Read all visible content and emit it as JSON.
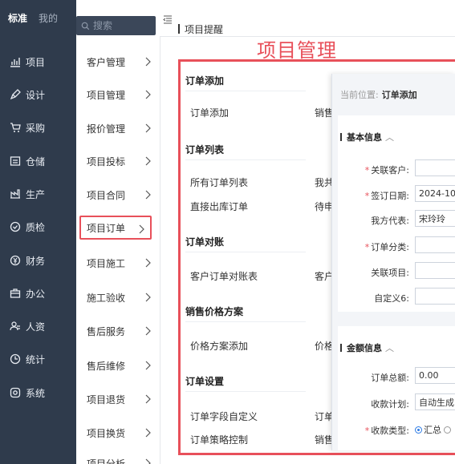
{
  "rail": {
    "tabs": [
      {
        "label": "标准",
        "active": true
      },
      {
        "label": "我的",
        "active": false
      }
    ],
    "items": [
      {
        "label": "项目",
        "icon": "chart-icon"
      },
      {
        "label": "设计",
        "icon": "pen-icon"
      },
      {
        "label": "采购",
        "icon": "cart-icon"
      },
      {
        "label": "仓储",
        "icon": "warehouse-icon"
      },
      {
        "label": "生产",
        "icon": "factory-icon"
      },
      {
        "label": "质检",
        "icon": "check-circle-icon"
      },
      {
        "label": "财务",
        "icon": "yen-icon"
      },
      {
        "label": "办公",
        "icon": "briefcase-icon"
      },
      {
        "label": "人资",
        "icon": "people-icon"
      },
      {
        "label": "统计",
        "icon": "clock-icon"
      },
      {
        "label": "系统",
        "icon": "settings-icon"
      }
    ]
  },
  "search": {
    "placeholder": "搜索"
  },
  "submenu": {
    "items": [
      {
        "label": "客户管理"
      },
      {
        "label": "项目管理"
      },
      {
        "label": "报价管理"
      },
      {
        "label": "项目投标"
      },
      {
        "label": "项目合同"
      },
      {
        "label": "项目订单",
        "selected": true
      },
      {
        "label": "项目施工"
      },
      {
        "label": "施工验收"
      },
      {
        "label": "售后服务"
      },
      {
        "label": "售后维修"
      },
      {
        "label": "项目退货"
      },
      {
        "label": "项目换货"
      },
      {
        "label": "项目分析"
      }
    ]
  },
  "header": {
    "breadcrumb": "项目提醒"
  },
  "big_title": "项目管理",
  "panel": {
    "groups": [
      {
        "title": "订单添加",
        "links": [
          {
            "left": "订单添加",
            "right": "销售"
          }
        ]
      },
      {
        "title": "订单列表",
        "links": [
          {
            "left": "所有订单列表",
            "right": "我共"
          },
          {
            "left": "直接出库订单",
            "right": "待申"
          }
        ]
      },
      {
        "title": "订单对账",
        "links": [
          {
            "left": "客户订单对账表",
            "right": "客户"
          }
        ]
      },
      {
        "title": "销售价格方案",
        "links": [
          {
            "left": "价格方案添加",
            "right": "价格"
          }
        ]
      },
      {
        "title": "订单设置",
        "links": [
          {
            "left": "订单字段自定义",
            "right": "订单"
          },
          {
            "left": "订单策略控制",
            "right": "销售"
          }
        ]
      }
    ]
  },
  "form": {
    "crumb_prefix": "当前位置:",
    "crumb_current": "订单添加",
    "basic": {
      "title": "基本信息",
      "fields": [
        {
          "label": "关联客户:",
          "required": true,
          "value": ""
        },
        {
          "label": "签订日期:",
          "required": true,
          "value": "2024-10-"
        },
        {
          "label": "我方代表:",
          "required": false,
          "value": "宋玲玲"
        },
        {
          "label": "订单分类:",
          "required": true,
          "value": ""
        },
        {
          "label": "关联项目:",
          "required": false,
          "value": ""
        },
        {
          "label": "自定义6:",
          "required": false,
          "value": ""
        }
      ]
    },
    "amount": {
      "title": "金额信息",
      "fields": [
        {
          "label": "订单总额:",
          "required": false,
          "value": "0.00"
        },
        {
          "label": "收款计划:",
          "required": false,
          "value": "自动生成"
        }
      ],
      "radio_label": "收款类型:",
      "radio_option": "汇总"
    }
  },
  "colors": {
    "rail_bg": "#2f3b4c",
    "accent_red": "#e8505a",
    "form_bg": "#f3f5f8",
    "radio_blue": "#2c7be5"
  }
}
